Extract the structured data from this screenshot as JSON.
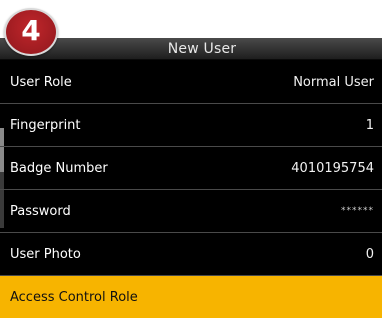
{
  "step_badge": "4",
  "window_title": "New User",
  "menu": [
    {
      "label": "User Role",
      "value": "Normal User"
    },
    {
      "label": "Fingerprint",
      "value": "1"
    },
    {
      "label": "Badge Number",
      "value": "4010195754"
    },
    {
      "label": "Password",
      "value": "******"
    },
    {
      "label": "User Photo",
      "value": "0"
    },
    {
      "label": "Access Control Role",
      "value": ""
    }
  ],
  "selected_index": 5,
  "colors": {
    "background": "#000000",
    "highlight": "#f7b400",
    "badge": "#9e1c21"
  }
}
